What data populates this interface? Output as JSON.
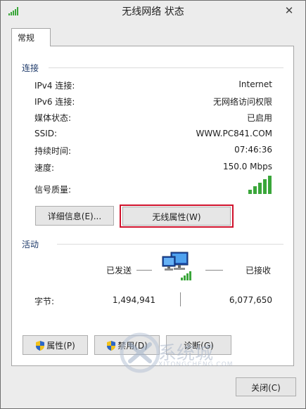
{
  "window": {
    "title": "无线网络 状态",
    "title_icon": "signal-bars-icon",
    "close_glyph": "✕"
  },
  "tabs": [
    {
      "label": "常规",
      "selected": true
    }
  ],
  "connection": {
    "section_title": "连接",
    "rows": [
      {
        "label": "IPv4 连接:",
        "value": "Internet"
      },
      {
        "label": "IPv6 连接:",
        "value": "无网络访问权限"
      },
      {
        "label": "媒体状态:",
        "value": "已启用"
      },
      {
        "label": "SSID:",
        "value": "WWW.PC841.COM"
      },
      {
        "label": "持续时间:",
        "value": "07:46:36"
      },
      {
        "label": "速度:",
        "value": "150.0 Mbps"
      }
    ],
    "signal_label": "信号质量:",
    "signal_bars_lit": 5,
    "signal_bars_total": 5,
    "details_button": "详细信息(E)...",
    "wireless_props_button": "无线属性(W)"
  },
  "activity": {
    "section_title": "活动",
    "sent_label": "已发送",
    "received_label": "已接收",
    "bytes_label": "字节:",
    "bytes_sent": "1,494,941",
    "bytes_received": "6,077,650",
    "network_icon": "network-computers-icon"
  },
  "bottom_buttons": {
    "properties": "属性(P)",
    "disable": "禁用(D)",
    "diagnose": "诊断(G)"
  },
  "footer": {
    "close_button": "关闭(C)"
  },
  "watermark": {
    "text": "系统城",
    "subtext": "XITONGCHENG.COM"
  },
  "colors": {
    "signal_green": "#3aa63a",
    "highlight_red": "#d0112b",
    "section_blue": "#1e3a6a"
  }
}
